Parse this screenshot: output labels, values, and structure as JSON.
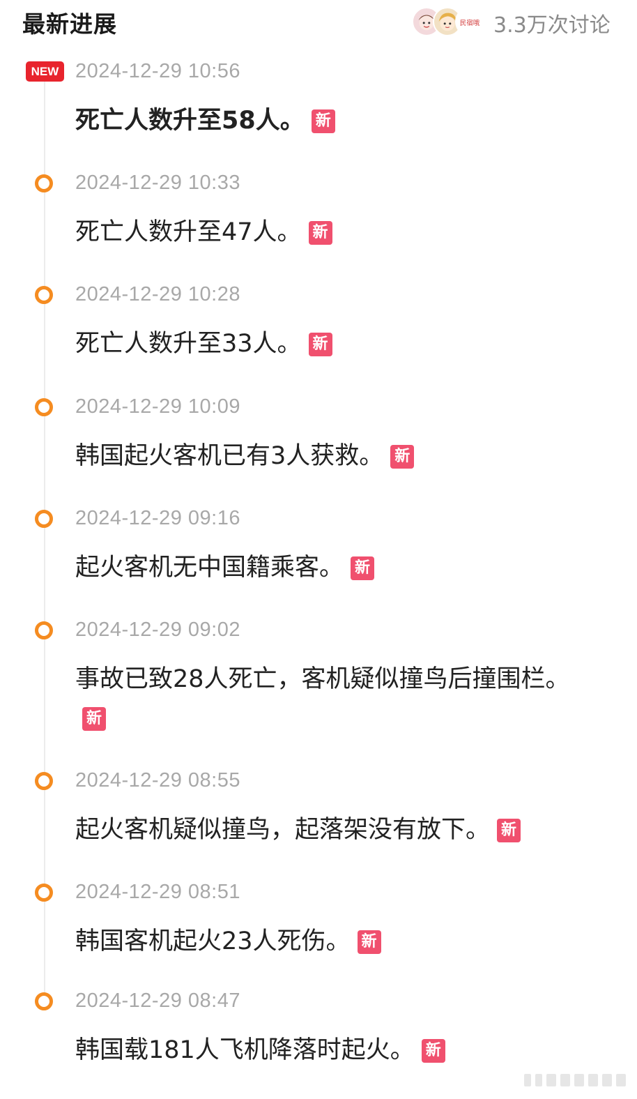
{
  "header": {
    "title": "最新进展",
    "discussion_count": "3.3万次讨论",
    "avatar_label": "民宿哦"
  },
  "badge": {
    "new_label": "NEW"
  },
  "tag_label": "新",
  "timeline": [
    {
      "time": "2024-12-29 10:56",
      "text": "死亡人数升至58人。"
    },
    {
      "time": "2024-12-29 10:33",
      "text": "死亡人数升至47人。"
    },
    {
      "time": "2024-12-29 10:28",
      "text": "死亡人数升至33人。"
    },
    {
      "time": "2024-12-29 10:09",
      "text": "韩国起火客机已有3人获救。"
    },
    {
      "time": "2024-12-29 09:16",
      "text": "起火客机无中国籍乘客。"
    },
    {
      "time": "2024-12-29 09:02",
      "text": "事故已致28人死亡，客机疑似撞鸟后撞围栏。"
    },
    {
      "time": "2024-12-29 08:55",
      "text": "起火客机疑似撞鸟，起落架没有放下。"
    },
    {
      "time": "2024-12-29 08:51",
      "text": "韩国客机起火23人死伤。"
    },
    {
      "time": "2024-12-29 08:47",
      "text": "韩国载181人飞机降落时起火。"
    }
  ],
  "colors": {
    "accent_orange": "#f58c21",
    "new_badge_red": "#e8242d",
    "tag_pink": "#f0506e"
  }
}
